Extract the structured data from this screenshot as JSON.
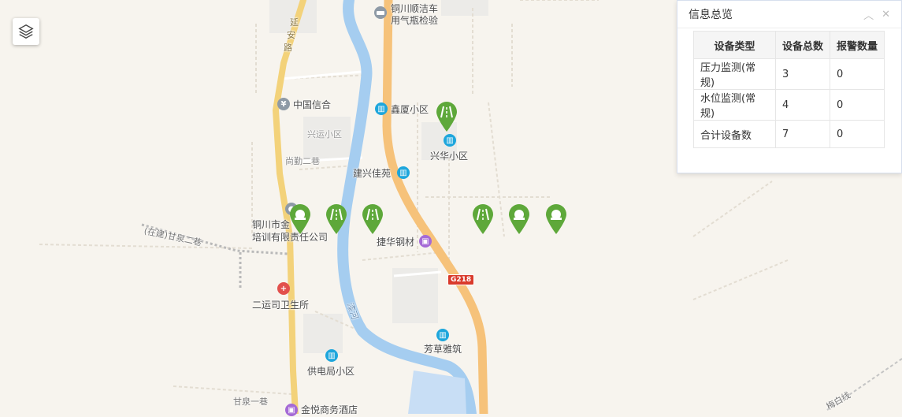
{
  "map": {
    "poi_labels": [
      "铜川顺洁车",
      "用气瓶检验",
      "中国信合",
      "鑫厦小区",
      "兴运小区",
      "兴华小区",
      "尚勤二巷",
      "建兴佳苑",
      "铜川市金",
      "培训有限责任公司",
      "(在建)甘泉二巷",
      "捷华钢材",
      "二运司卫生所",
      "芳草雅筑",
      "供电局小区",
      "甘泉一巷",
      "金悦商务酒店"
    ],
    "road_labels": [
      "延",
      "安",
      "路",
      "漆河"
    ],
    "highway_badge": "G218",
    "railway_label": "梅白线"
  },
  "markers": [
    {
      "type": "station"
    },
    {
      "type": "road"
    },
    {
      "type": "road"
    },
    {
      "type": "road"
    },
    {
      "type": "road"
    },
    {
      "type": "station"
    },
    {
      "type": "station"
    }
  ],
  "info_panel": {
    "title": "信息总览",
    "headers": [
      "设备类型",
      "设备总数",
      "报警数量"
    ],
    "rows": [
      [
        "压力监测(常规)",
        "3",
        "0"
      ],
      [
        "水位监测(常规)",
        "4",
        "0"
      ],
      [
        "合计设备数",
        "7",
        "0"
      ]
    ]
  },
  "colors": {
    "marker_green": "#5ea83a",
    "river": "#a5cdf0",
    "highway": "#f6c27a",
    "road": "#f3d27a",
    "hospital": "#e2504c",
    "poi_blue": "#1ea6dc"
  }
}
